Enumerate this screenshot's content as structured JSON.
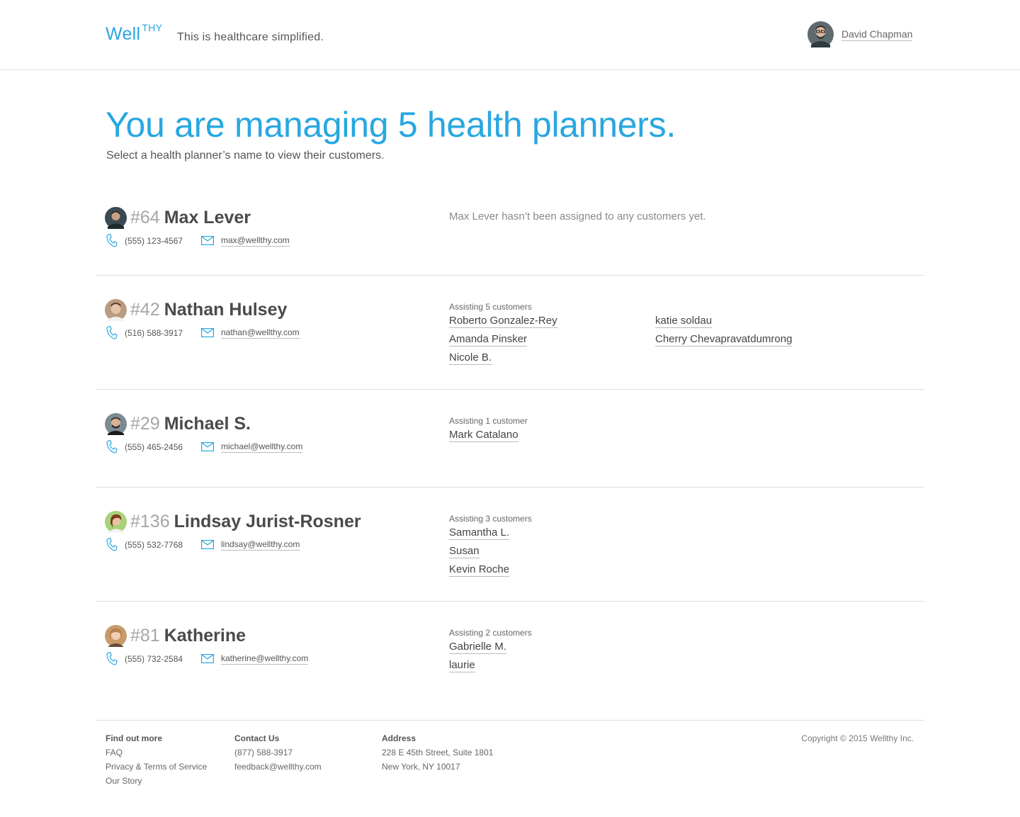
{
  "header": {
    "logo_main": "Well",
    "logo_sup": "THY",
    "tagline": "This is healthcare simplified.",
    "user_name": "David Chapman"
  },
  "main": {
    "title": "You are managing 5 health planners.",
    "subtitle": "Select a health planner’s name to view their customers."
  },
  "planners": [
    {
      "number": "#64",
      "name": "Max Lever",
      "phone": "(555) 123-4567",
      "email": "max@wellthy.com",
      "message": "Max Lever hasn’t been assigned to any customers yet.",
      "assisting": "",
      "customers": []
    },
    {
      "number": "#42",
      "name": "Nathan Hulsey",
      "phone": "(516) 588-3917",
      "email": "nathan@wellthy.com",
      "message": "",
      "assisting": "Assisting 5 customers",
      "customers": [
        "Roberto Gonzalez-Rey",
        "Amanda Pinsker",
        "Nicole B.",
        "katie soldau",
        "Cherry Chevapravatdumrong"
      ]
    },
    {
      "number": "#29",
      "name": "Michael S.",
      "phone": "(555) 465-2456",
      "email": "michael@wellthy.com",
      "message": "",
      "assisting": "Assisting 1 customer",
      "customers": [
        "Mark Catalano"
      ]
    },
    {
      "number": "#136",
      "name": "Lindsay Jurist-Rosner",
      "phone": "(555) 532-7768",
      "email": "lindsay@wellthy.com",
      "message": "",
      "assisting": "Assisting 3 customers",
      "customers": [
        "Samantha L.",
        "Susan",
        "Kevin Roche"
      ]
    },
    {
      "number": "#81",
      "name": "Katherine",
      "phone": "(555) 732-2584",
      "email": "katherine@wellthy.com",
      "message": "",
      "assisting": "Assisting 2 customers",
      "customers": [
        "Gabrielle M.",
        "laurie"
      ]
    }
  ],
  "footer": {
    "find_out_more": {
      "heading": "Find out more",
      "items": [
        "FAQ",
        "Privacy & Terms of Service",
        "Our Story"
      ]
    },
    "contact_us": {
      "heading": "Contact Us",
      "items": [
        "(877) 588-3917",
        "feedback@wellthy.com"
      ]
    },
    "address": {
      "heading": "Address",
      "items": [
        "228 E 45th Street, Suite 1801",
        "New York, NY 10017"
      ]
    },
    "copyright": "Copyright © 2015 Wellthy  Inc."
  },
  "colors": {
    "accent": "#28a7e1",
    "text": "#4a4a4a",
    "divider": "#dcdcdc"
  },
  "icons": {
    "phone": "phone-icon",
    "email": "mail-icon",
    "avatar": "avatar"
  }
}
